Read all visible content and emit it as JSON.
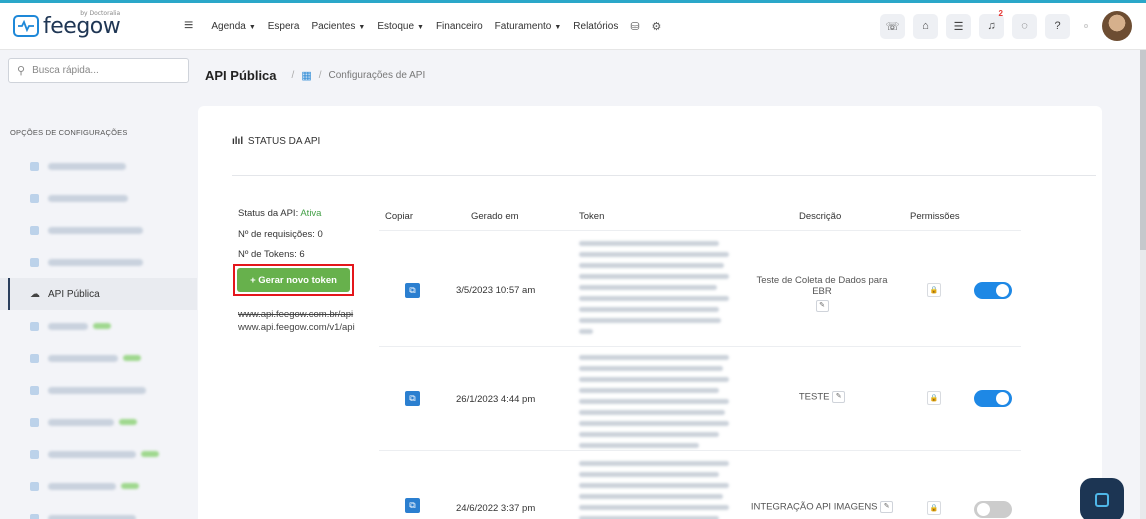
{
  "app": {
    "logo_text": "feegow",
    "logo_sub": "by Doctoralia"
  },
  "nav": [
    {
      "label": "Agenda",
      "dropdown": true
    },
    {
      "label": "Espera",
      "dropdown": false
    },
    {
      "label": "Pacientes",
      "dropdown": true
    },
    {
      "label": "Estoque",
      "dropdown": true
    },
    {
      "label": "Financeiro",
      "dropdown": false
    },
    {
      "label": "Faturamento",
      "dropdown": true
    },
    {
      "label": "Relatórios",
      "dropdown": false
    }
  ],
  "topbar": {
    "notification_count": "2",
    "icons": [
      "phone-icon",
      "inbox-icon",
      "checklist-icon",
      "bell-icon",
      "chat-icon",
      "help-icon"
    ]
  },
  "search": {
    "placeholder": "Busca rápida..."
  },
  "sidebar": {
    "title": "OPÇÕES DE CONFIGURAÇÕES",
    "active_label": "API Pública"
  },
  "breadcrumb": {
    "title": "API Pública",
    "current": "Configurações de API"
  },
  "status": {
    "title": "STATUS DA API",
    "api_status_label": "Status da API:",
    "api_status_value": "Ativa",
    "requests_label": "Nº de requisições:",
    "requests_value": "0",
    "tokens_label": "Nº de Tokens:",
    "tokens_value": "6",
    "generate_button": "+ Gerar novo token",
    "url_old": "www.api.feegow.com.br/api",
    "url_new": "www.api.feegow.com/v1/api"
  },
  "table": {
    "headers": {
      "copy": "Copiar",
      "generated": "Gerado em",
      "token": "Token",
      "description": "Descrição",
      "permissions": "Permissões"
    },
    "rows": [
      {
        "date": "3/5/2023 10:57 am",
        "description": "Teste de Coleta de Dados para EBR",
        "active": true
      },
      {
        "date": "26/1/2023 4:44 pm",
        "description": "TESTE",
        "active": true
      },
      {
        "date": "24/6/2022 3:37 pm",
        "description": "INTEGRAÇÃO API IMAGENS",
        "active": false
      }
    ]
  },
  "colors": {
    "brand": "#1e88d8",
    "accent_green": "#67b14c",
    "highlight_red": "#e4161b",
    "toggle_on": "#1e88e5"
  }
}
